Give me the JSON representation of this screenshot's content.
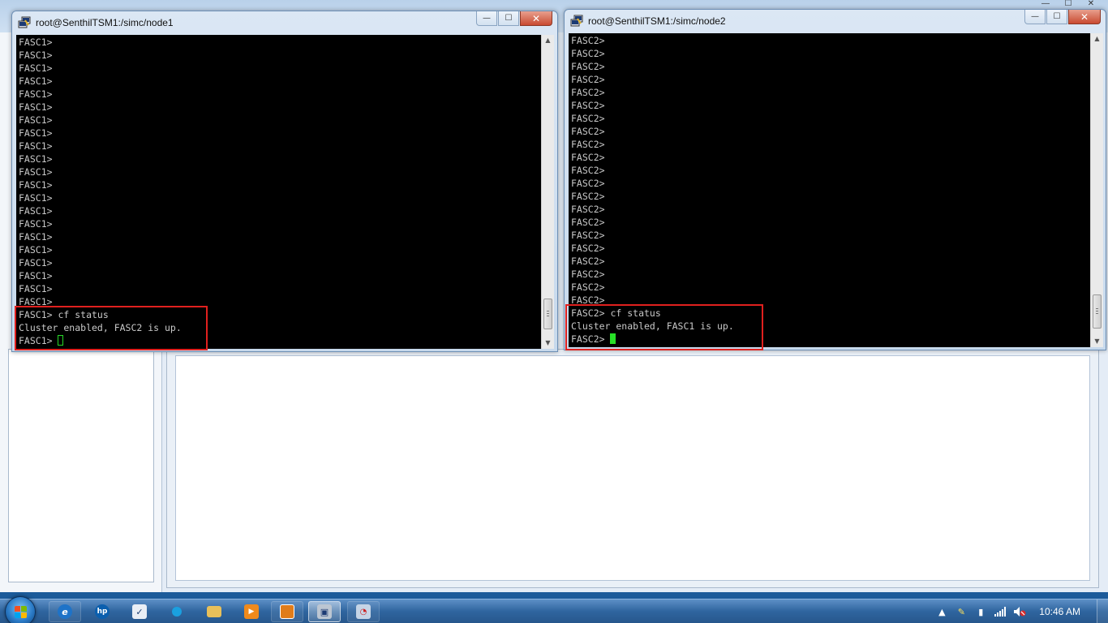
{
  "window1": {
    "title": "root@SenthilTSM1:/simc/node1",
    "lines": [
      "FASC1>",
      "FASC1>",
      "FASC1>",
      "FASC1>",
      "FASC1>",
      "FASC1>",
      "FASC1>",
      "FASC1>",
      "FASC1>",
      "FASC1>",
      "FASC1>",
      "FASC1>",
      "FASC1>",
      "FASC1>",
      "FASC1>",
      "FASC1>",
      "FASC1>",
      "FASC1>",
      "FASC1>",
      "FASC1>",
      "FASC1>"
    ],
    "command_line": "FASC1> cf status",
    "output_line": "Cluster enabled, FASC2 is up.",
    "prompt": "FASC1> "
  },
  "window2": {
    "title": "root@SenthilTSM1:/simc/node2",
    "lines": [
      "FASC2>",
      "FASC2>",
      "FASC2>",
      "FASC2>",
      "FASC2>",
      "FASC2>",
      "FASC2>",
      "FASC2>",
      "FASC2>",
      "FASC2>",
      "FASC2>",
      "FASC2>",
      "FASC2>",
      "FASC2>",
      "FASC2>",
      "FASC2>",
      "FASC2>",
      "FASC2>",
      "FASC2>",
      "FASC2>",
      "FASC2>"
    ],
    "command_line": "FASC2> cf status",
    "output_line": "Cluster enabled, FASC1 is up.",
    "prompt": "FASC2> "
  },
  "window_controls": {
    "minimize": "—",
    "maximize": "☐",
    "close": "✕"
  },
  "taskbar": {
    "clock": "10:46 AM",
    "pinned": [
      {
        "icon": "ie-icon",
        "color": "#1e73c8"
      },
      {
        "icon": "hp-icon",
        "color": "#0b5fae"
      },
      {
        "icon": "tasks-icon",
        "color": "#e9eef5"
      },
      {
        "icon": "media-center-icon",
        "color": "#1aa0e0"
      },
      {
        "icon": "folder-icon",
        "color": "#e8c05a"
      },
      {
        "icon": "media-player-icon",
        "color": "#f08a1c"
      },
      {
        "icon": "app-icon",
        "color": "#e07c1a"
      },
      {
        "icon": "putty-icon",
        "color": "#bcc6d2"
      },
      {
        "icon": "remote-icon",
        "color": "#c5d4e6"
      }
    ]
  },
  "colors": {
    "terminal_bg": "#000000",
    "terminal_fg": "#c8c8c8",
    "cursor": "#27e027",
    "highlight_box": "#e0201e"
  }
}
